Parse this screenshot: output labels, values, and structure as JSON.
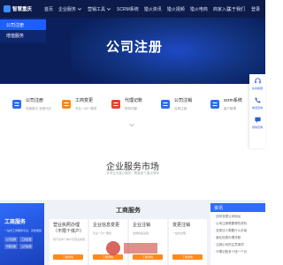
{
  "header": {
    "logo_text": "智慧重庆",
    "nav": [
      "首页",
      "企业服务",
      "营销工具",
      "SCRM系统",
      "猎火资讯",
      "猎火视频",
      "猎火电商",
      "商家入驻"
    ],
    "nav_dropdowns": [
      false,
      true,
      true,
      false,
      false,
      false,
      false,
      false
    ],
    "right_links": [
      "关于我们",
      "登录"
    ]
  },
  "dropdown": {
    "items": [
      "公司注册",
      "增值服务"
    ]
  },
  "hero": {
    "title": "公司注册"
  },
  "services": [
    {
      "title": "公司注册",
      "desc": "快速登记 全程代办",
      "color": "#2b6cf0"
    },
    {
      "title": "工商变更",
      "desc": "专业一对一服务",
      "color": "#f28a1f"
    },
    {
      "title": "代理记账",
      "desc": "财务托管",
      "color": "#e9412e"
    },
    {
      "title": "公司注销",
      "desc": "合规注销",
      "color": "#2b6cf0"
    },
    {
      "title": "scrm系统",
      "desc": "客户管理",
      "color": "#2b6cf0"
    }
  ],
  "sidebar": [
    {
      "label": "在线客服",
      "icon": "headset-icon"
    },
    {
      "label": "电话咨询",
      "icon": "phone-icon"
    },
    {
      "label": "微信咨询",
      "icon": "chat-icon"
    }
  ],
  "market": {
    "title": "企业服务市场",
    "subtitle": "多项企业核心服务，覆盖各个重点领域"
  },
  "bottom": {
    "left_card": {
      "title": "工商服务",
      "desc": "一站式工商服务平台，高效便捷",
      "tags": [
        "公司注册",
        "工商变更",
        "代理记账",
        "公司注销"
      ]
    },
    "section_title": "工商服务",
    "cards": [
      {
        "title": "营业执照办理（不限个体户）",
        "desc": "用于合作个体户及营业执照",
        "button": "了解详情"
      },
      {
        "title": "企业信息变更",
        "desc": "专业一对一服务",
        "button": "了解详情"
      },
      {
        "title": "企业注销",
        "desc": "合规快速注销",
        "button": "了解详情"
      },
      {
        "title": "变更注销",
        "desc": "一站式办理",
        "button": "了解详情"
      }
    ],
    "right_panel": {
      "header": "资讯",
      "items": [
        "· 如何变更公司地址",
        "· 公司注册需要哪些资料",
        "· 变更法人需要什么手续",
        "· 营业执照办理流程",
        "· 注销公司的注意事项",
        "· 代理记账多少钱一个月"
      ]
    }
  },
  "colors": {
    "nav_bg": "#0d1b4a",
    "hero_bg": "#0a1f5c",
    "accent": "#1d5eff",
    "button": "#ff8a1c"
  }
}
